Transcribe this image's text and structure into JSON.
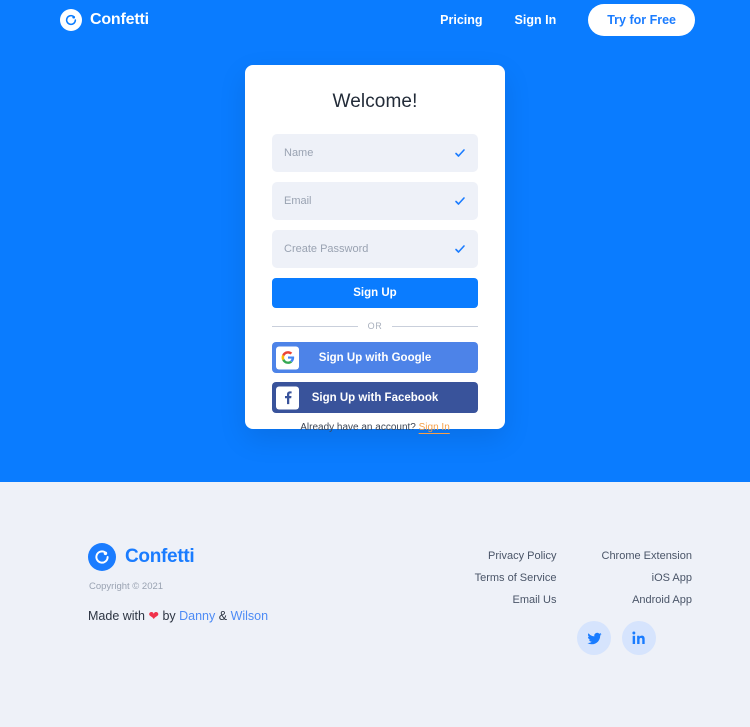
{
  "nav": {
    "brand": "Confetti",
    "logo_icon": "confetti-logo-icon",
    "links": [
      {
        "label": "Pricing",
        "name": "nav-link-pricing"
      },
      {
        "label": "Sign In",
        "name": "nav-link-signin"
      }
    ],
    "cta_label": "Try for Free"
  },
  "card": {
    "title": "Welcome!",
    "fields": [
      {
        "placeholder": "Name",
        "value": "",
        "name": "name-input",
        "check_icon": "check-icon"
      },
      {
        "placeholder": "Email",
        "value": "",
        "name": "email-input",
        "check_icon": "check-icon"
      },
      {
        "placeholder": "Create Password",
        "value": "",
        "name": "password-input",
        "check_icon": "check-icon"
      }
    ],
    "signup_label": "Sign Up",
    "divider_label": "OR",
    "google_label": "Sign Up with Google",
    "google_icon": "google-icon",
    "facebook_label": "Sign Up with Facebook",
    "facebook_icon": "facebook-icon",
    "footnote_text": "Already have an account?",
    "footnote_link": "Sign In"
  },
  "footer": {
    "brand": "Confetti",
    "logo_icon": "confetti-logo-icon",
    "copyright": "Copyright © 2021",
    "made_prefix": "Made with",
    "heart_icon": "heart-icon",
    "made_by": "by",
    "author_one": "Danny",
    "made_sep": "&",
    "author_two": "Wilson",
    "link_columns": [
      {
        "links": [
          {
            "label": "Privacy Policy",
            "name": "footer-link-privacy-policy"
          },
          {
            "label": "Terms of Service",
            "name": "footer-link-terms-of-service"
          },
          {
            "label": "Email Us",
            "name": "footer-link-email-us"
          }
        ]
      },
      {
        "links": [
          {
            "label": "Chrome Extension",
            "name": "footer-link-chrome-extension"
          },
          {
            "label": "iOS App",
            "name": "footer-link-ios-app"
          },
          {
            "label": "Android App",
            "name": "footer-link-android-app"
          }
        ]
      }
    ],
    "socials": [
      {
        "name": "twitter-icon",
        "label": "Twitter"
      },
      {
        "name": "linkedin-icon",
        "label": "LinkedIn"
      }
    ]
  },
  "colors": {
    "hero_blue": "#0a7cff",
    "footer_bg": "#eef1f8",
    "field_bg": "#eef1f8",
    "google_blue": "#4d83e8",
    "facebook_blue": "#39539b",
    "signin_orange": "#f5a04a",
    "heart_red": "#f0324b",
    "brand_blue": "#1a7cff"
  }
}
